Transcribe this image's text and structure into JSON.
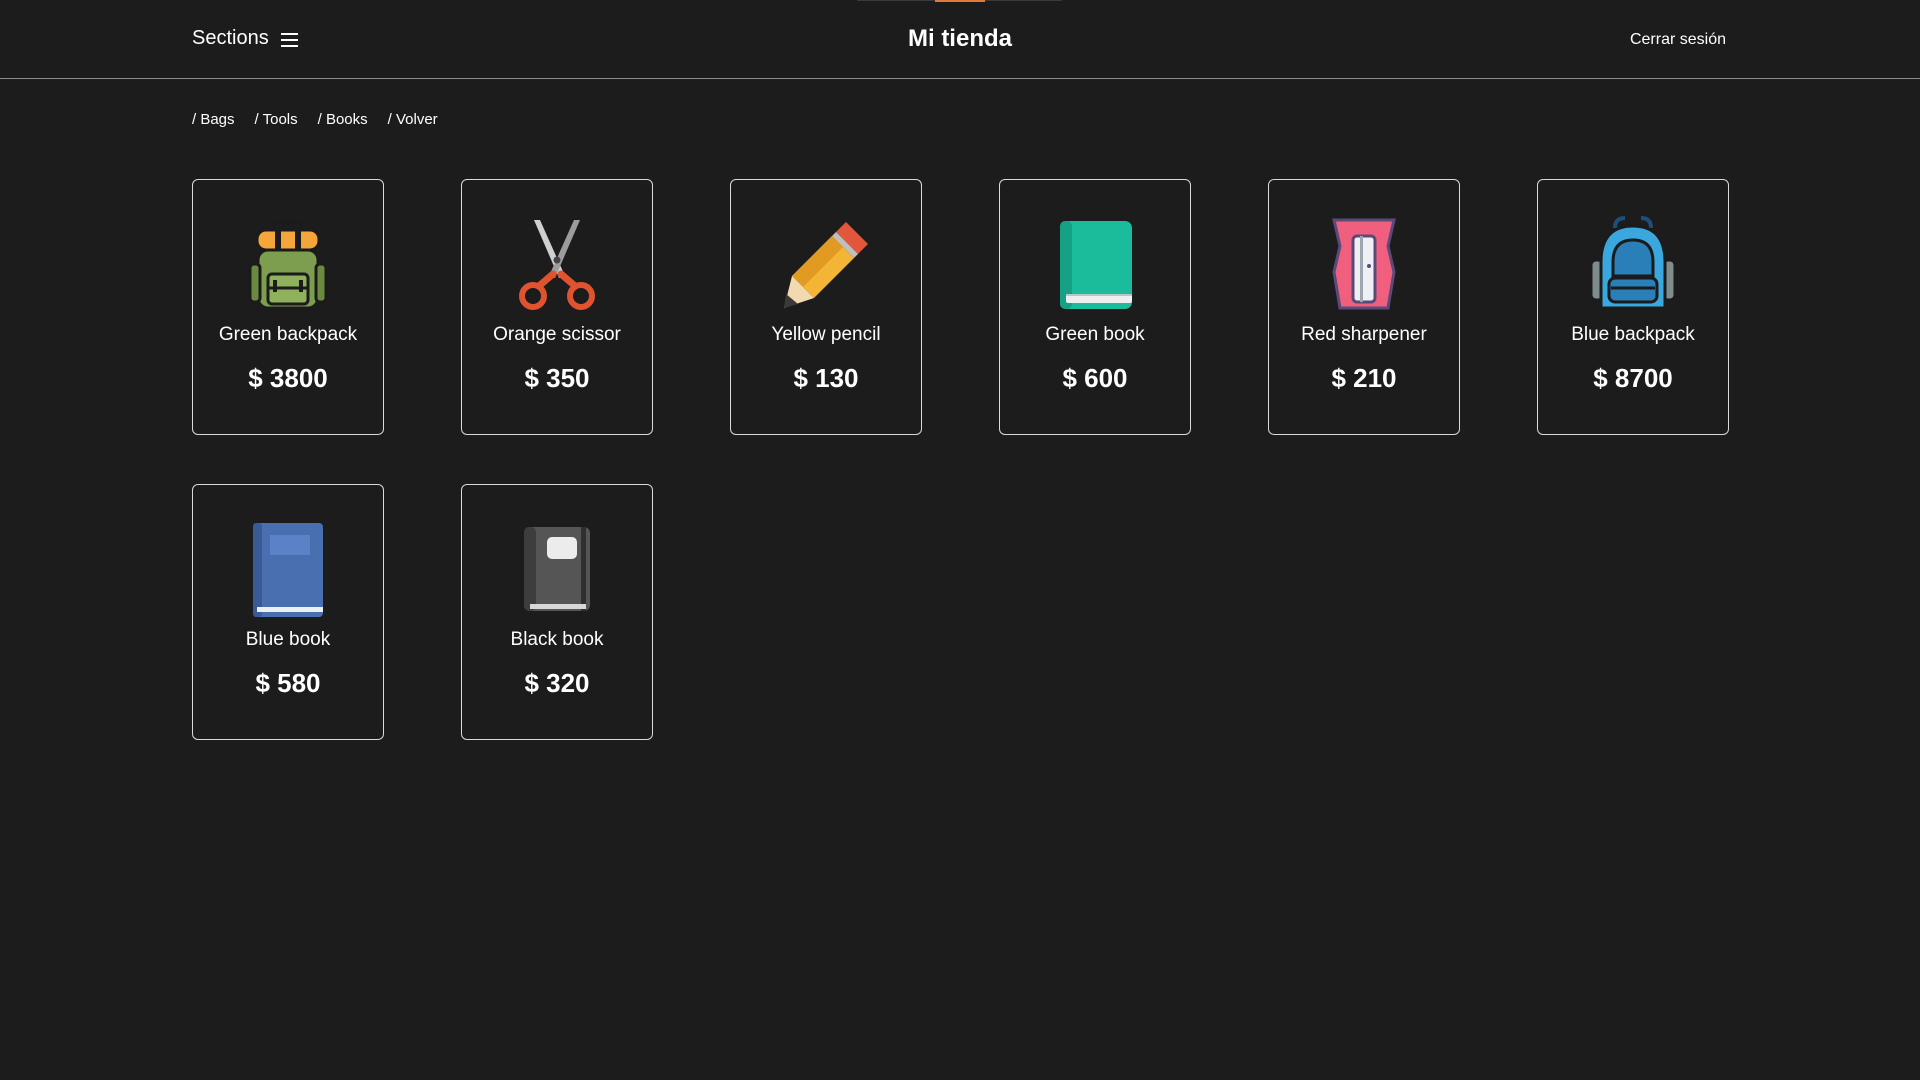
{
  "header": {
    "sections_label": "Sections",
    "brand": "Mi tienda",
    "logout_label": "Cerrar sesión",
    "accent_color": "#e07a3a"
  },
  "breadcrumbs": [
    {
      "label": "/ Bags"
    },
    {
      "label": "/ Tools"
    },
    {
      "label": "/ Books"
    },
    {
      "label": "/ Volver"
    }
  ],
  "products": [
    {
      "name": "Green backpack",
      "price": "$ 3800",
      "icon": "green-backpack-icon"
    },
    {
      "name": "Orange scissor",
      "price": "$ 350",
      "icon": "orange-scissor-icon"
    },
    {
      "name": "Yellow pencil",
      "price": "$ 130",
      "icon": "yellow-pencil-icon"
    },
    {
      "name": "Green book",
      "price": "$ 600",
      "icon": "green-book-icon"
    },
    {
      "name": "Red sharpener",
      "price": "$ 210",
      "icon": "red-sharpener-icon"
    },
    {
      "name": "Blue backpack",
      "price": "$ 8700",
      "icon": "blue-backpack-icon"
    },
    {
      "name": "Blue book",
      "price": "$ 580",
      "icon": "blue-book-icon"
    },
    {
      "name": "Black book",
      "price": "$ 320",
      "icon": "black-book-icon"
    }
  ],
  "colors": {
    "background": "#1c1c1c",
    "text": "#ffffff",
    "card_border": "#d9d9d9"
  }
}
